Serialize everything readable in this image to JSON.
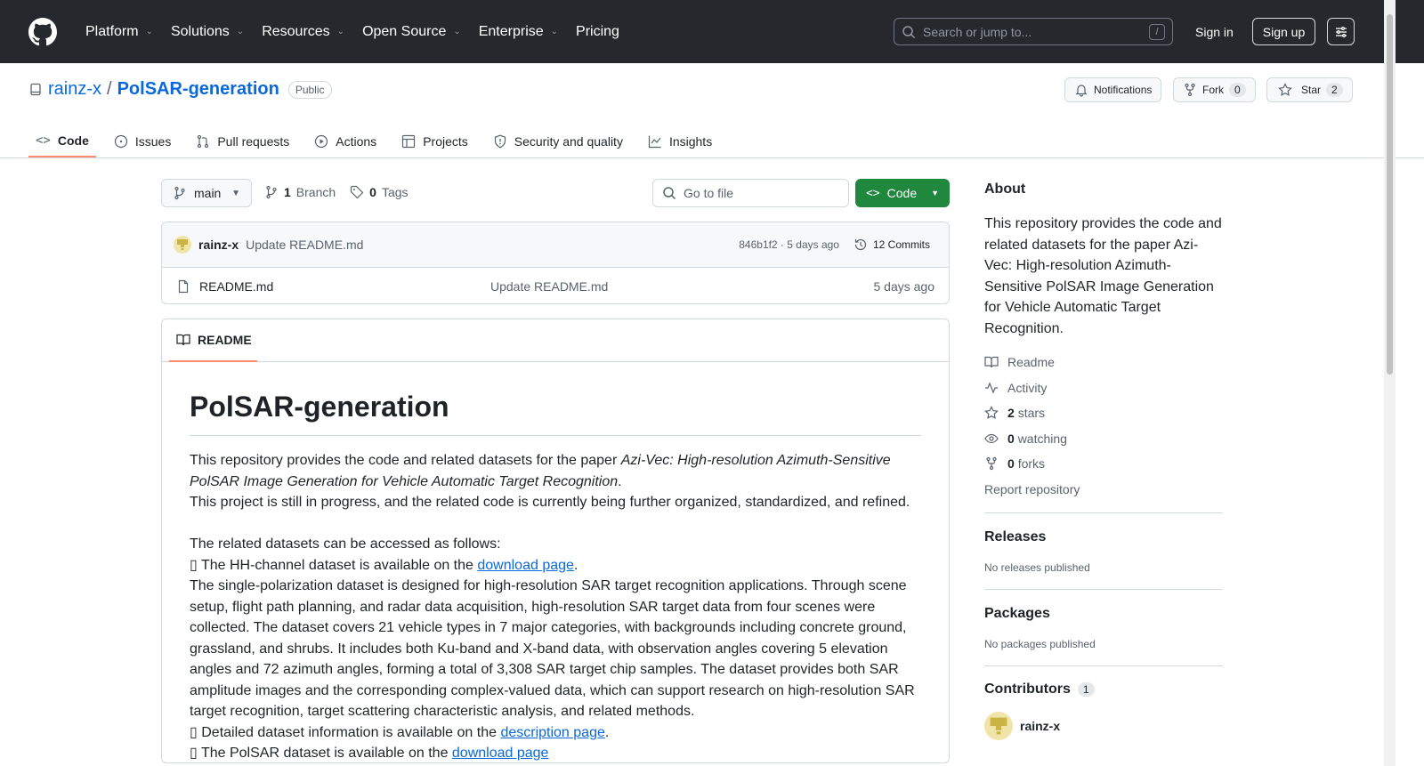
{
  "header": {
    "nav": [
      "Platform",
      "Solutions",
      "Resources",
      "Open Source",
      "Enterprise",
      "Pricing"
    ],
    "search_placeholder": "Search or jump to...",
    "search_key": "/",
    "signin": "Sign in",
    "signup": "Sign up"
  },
  "repo": {
    "owner": "rainz-x",
    "separator": "/",
    "name": "PolSAR-generation",
    "visibility": "Public",
    "notifications": "Notifications",
    "fork_label": "Fork",
    "fork_count": "0",
    "star_label": "Star",
    "star_count": "2",
    "tabs": [
      "Code",
      "Issues",
      "Pull requests",
      "Actions",
      "Projects",
      "Security and quality",
      "Insights"
    ]
  },
  "code": {
    "branch": "main",
    "branch_count": "1",
    "branch_label": "Branch",
    "tag_count": "0",
    "tag_label": "Tags",
    "goto_placeholder": "Go to file",
    "code_button": "Code",
    "commit_author": "rainz-x",
    "commit_message": "Update README.md",
    "commit_hash": "846b1f2 · 5 days ago",
    "commit_count": "12 Commits",
    "files": [
      {
        "name": "README.md",
        "message": "Update README.md",
        "time": "5 days ago"
      }
    ]
  },
  "readme": {
    "tab_label": "README",
    "title": "PolSAR-generation",
    "p1_a": "This repository provides the code and related datasets for the paper ",
    "p1_em": "Azi-Vec: High-resolution Azimuth-Sensitive PolSAR Image Generation for Vehicle Automatic Target Recognition",
    "p1_b": ".",
    "p2": "This project is still in progress, and the related code is currently being further organized, standardized, and refined.",
    "p3": "The related datasets can be accessed as follows:",
    "li1_a": "▯ The HH-channel dataset is available on the ",
    "li1_link": "download page",
    "li1_b": ".",
    "p4": "The single-polarization dataset is designed for high-resolution SAR target recognition applications. Through scene setup, flight path planning, and radar data acquisition, high-resolution SAR target data from four scenes were collected. The dataset covers 21 vehicle types in 7 major categories, with backgrounds including concrete ground, grassland, and shrubs. It includes both Ku-band and X-band data, with observation angles covering 5 elevation angles and 72 azimuth angles, forming a total of 3,308 SAR target chip samples. The dataset provides both SAR amplitude images and the corresponding complex-valued data, which can support research on high-resolution SAR target recognition, target scattering characteristic analysis, and related methods.",
    "li2_a": "▯ Detailed dataset information is available on the ",
    "li2_link": "description page",
    "li2_b": ".",
    "li3_a": "▯ The PolSAR dataset is available on the ",
    "li3_link": "download page"
  },
  "sidebar": {
    "about": "About",
    "description": "This repository provides the code and related datasets for the paper Azi-Vec: High-resolution Azimuth-Sensitive PolSAR Image Generation for Vehicle Automatic Target Recognition.",
    "readme": "Readme",
    "activity": "Activity",
    "stars_count": "2",
    "stars_label": "stars",
    "watching_count": "0",
    "watching_label": "watching",
    "forks_count": "0",
    "forks_label": "forks",
    "report": "Report repository",
    "releases": "Releases",
    "no_releases": "No releases published",
    "packages": "Packages",
    "no_packages": "No packages published",
    "contributors": "Contributors",
    "contributors_count": "1",
    "contributor_name": "rainz-x"
  },
  "colors": {
    "header_bg": "#25292e",
    "link": "#0969da",
    "green": "#1f883d",
    "tab_underline": "#fd8c73"
  }
}
